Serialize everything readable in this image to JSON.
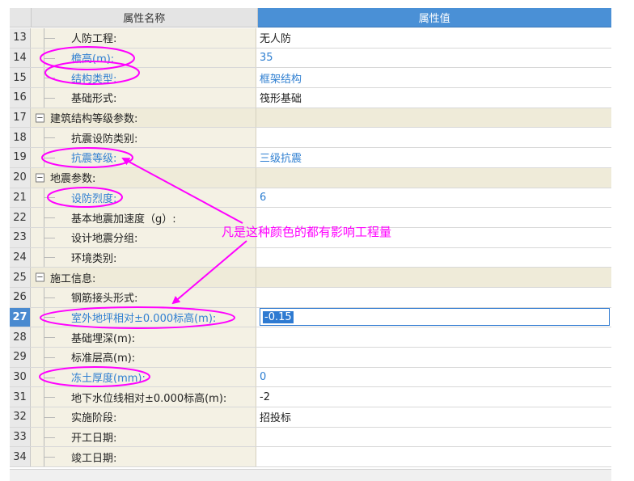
{
  "header": {
    "name_col": "属性名称",
    "value_col": "属性值"
  },
  "rows": [
    {
      "num": "13",
      "label": "人防工程:",
      "value": "无人防",
      "type": "child",
      "highlight": false
    },
    {
      "num": "14",
      "label": "檐高(m):",
      "value": "35",
      "type": "child",
      "highlight": true
    },
    {
      "num": "15",
      "label": "结构类型:",
      "value": "框架结构",
      "type": "child",
      "highlight": true
    },
    {
      "num": "16",
      "label": "基础形式:",
      "value": "筏形基础",
      "type": "child",
      "highlight": false
    },
    {
      "num": "17",
      "label": "建筑结构等级参数:",
      "value": "",
      "type": "group",
      "highlight": false
    },
    {
      "num": "18",
      "label": "抗震设防类别:",
      "value": "",
      "type": "child",
      "highlight": false
    },
    {
      "num": "19",
      "label": "抗震等级:",
      "value": "三级抗震",
      "type": "child",
      "highlight": true
    },
    {
      "num": "20",
      "label": "地震参数:",
      "value": "",
      "type": "group",
      "highlight": false
    },
    {
      "num": "21",
      "label": "设防烈度:",
      "value": "6",
      "type": "child",
      "highlight": true
    },
    {
      "num": "22",
      "label": "基本地震加速度（g）:",
      "value": "",
      "type": "child",
      "highlight": false
    },
    {
      "num": "23",
      "label": "设计地震分组:",
      "value": "",
      "type": "child",
      "highlight": false
    },
    {
      "num": "24",
      "label": "环境类别:",
      "value": "",
      "type": "child",
      "highlight": false
    },
    {
      "num": "25",
      "label": "施工信息:",
      "value": "",
      "type": "group",
      "highlight": false
    },
    {
      "num": "26",
      "label": "钢筋接头形式:",
      "value": "",
      "type": "child",
      "highlight": false
    },
    {
      "num": "27",
      "label": "室外地坪相对±0.000标高(m):",
      "value": "-0.15",
      "type": "child",
      "highlight": true,
      "active": true
    },
    {
      "num": "28",
      "label": "基础埋深(m):",
      "value": "",
      "type": "child",
      "highlight": false
    },
    {
      "num": "29",
      "label": "标准层高(m):",
      "value": "",
      "type": "child",
      "highlight": false
    },
    {
      "num": "30",
      "label": "冻土厚度(mm):",
      "value": "0",
      "type": "child",
      "highlight": true
    },
    {
      "num": "31",
      "label": "地下水位线相对±0.000标高(m):",
      "value": "-2",
      "type": "child",
      "highlight": false
    },
    {
      "num": "32",
      "label": "实施阶段:",
      "value": "招投标",
      "type": "child",
      "highlight": false
    },
    {
      "num": "33",
      "label": "开工日期:",
      "value": "",
      "type": "child",
      "highlight": false
    },
    {
      "num": "34",
      "label": "竣工日期:",
      "value": "",
      "type": "child",
      "highlight": false
    }
  ],
  "annotation": {
    "text": "凡是这种颜色的都有影响工程量",
    "color": "#ff00ff"
  },
  "colors": {
    "header_value_bg": "#4a90d6",
    "name_bg": "#f4f1e4",
    "group_bg": "#efebd9",
    "highlight_text": "#2f7fd1",
    "active_row": "#4a8ad0"
  },
  "icons": {
    "collapse": "minus-box-icon"
  }
}
